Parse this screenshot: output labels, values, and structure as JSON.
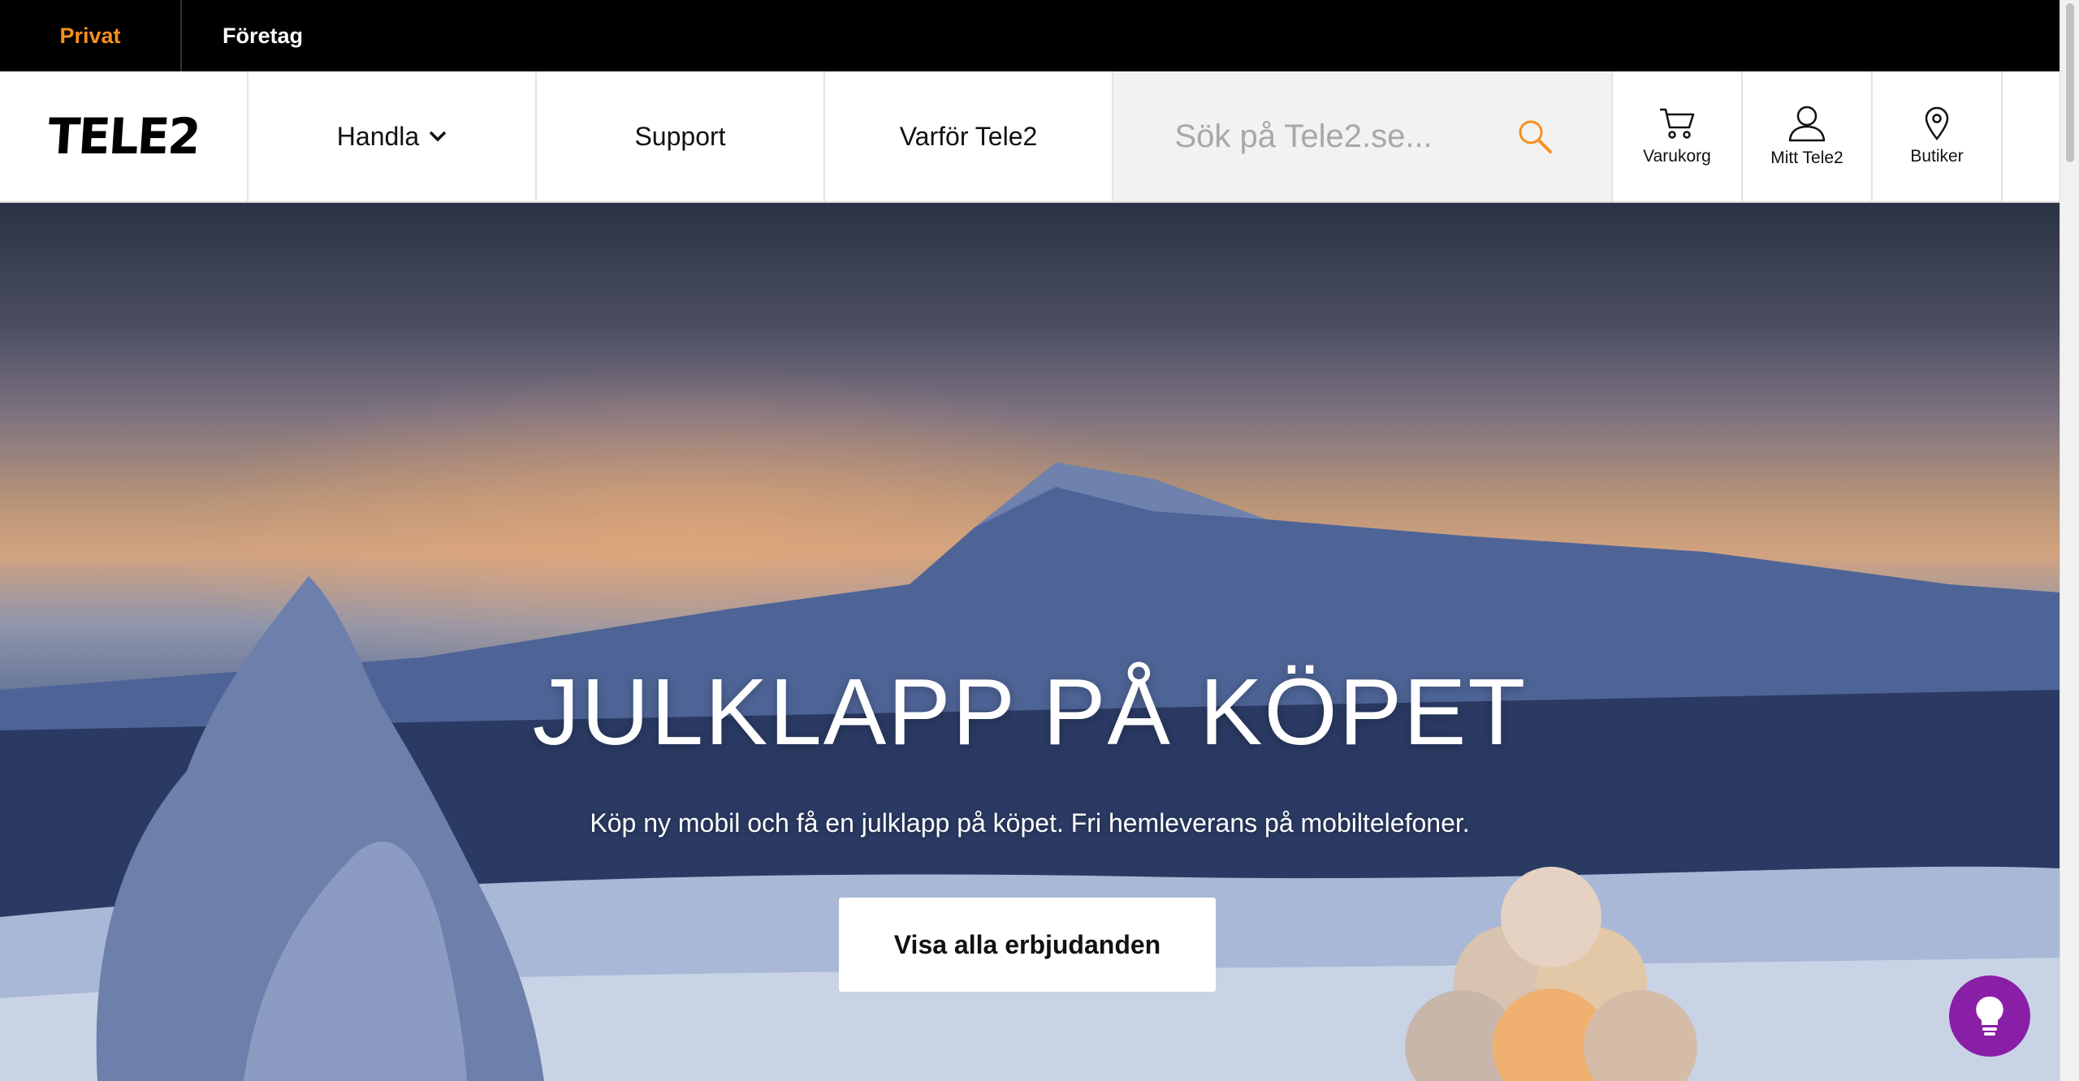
{
  "topbar": {
    "privat": "Privat",
    "foretag": "Företag",
    "accent_color": "#f7901e"
  },
  "nav": {
    "logo": "TELE2",
    "handla": "Handla",
    "support": "Support",
    "varfor": "Varför Tele2",
    "search_placeholder": "Sök på Tele2.se...",
    "cart_label": "Varukorg",
    "account_label": "Mitt Tele2",
    "stores_label": "Butiker"
  },
  "hero": {
    "title": "JULKLAPP PÅ KÖPET",
    "subtitle": "Köp ny mobil och få en julklapp på köpet. Fri hemleverans på mobiltelefoner.",
    "cta": "Visa alla erbjudanden"
  },
  "help_button": {
    "icon": "lightbulb-icon",
    "color": "#8a1fa7"
  }
}
